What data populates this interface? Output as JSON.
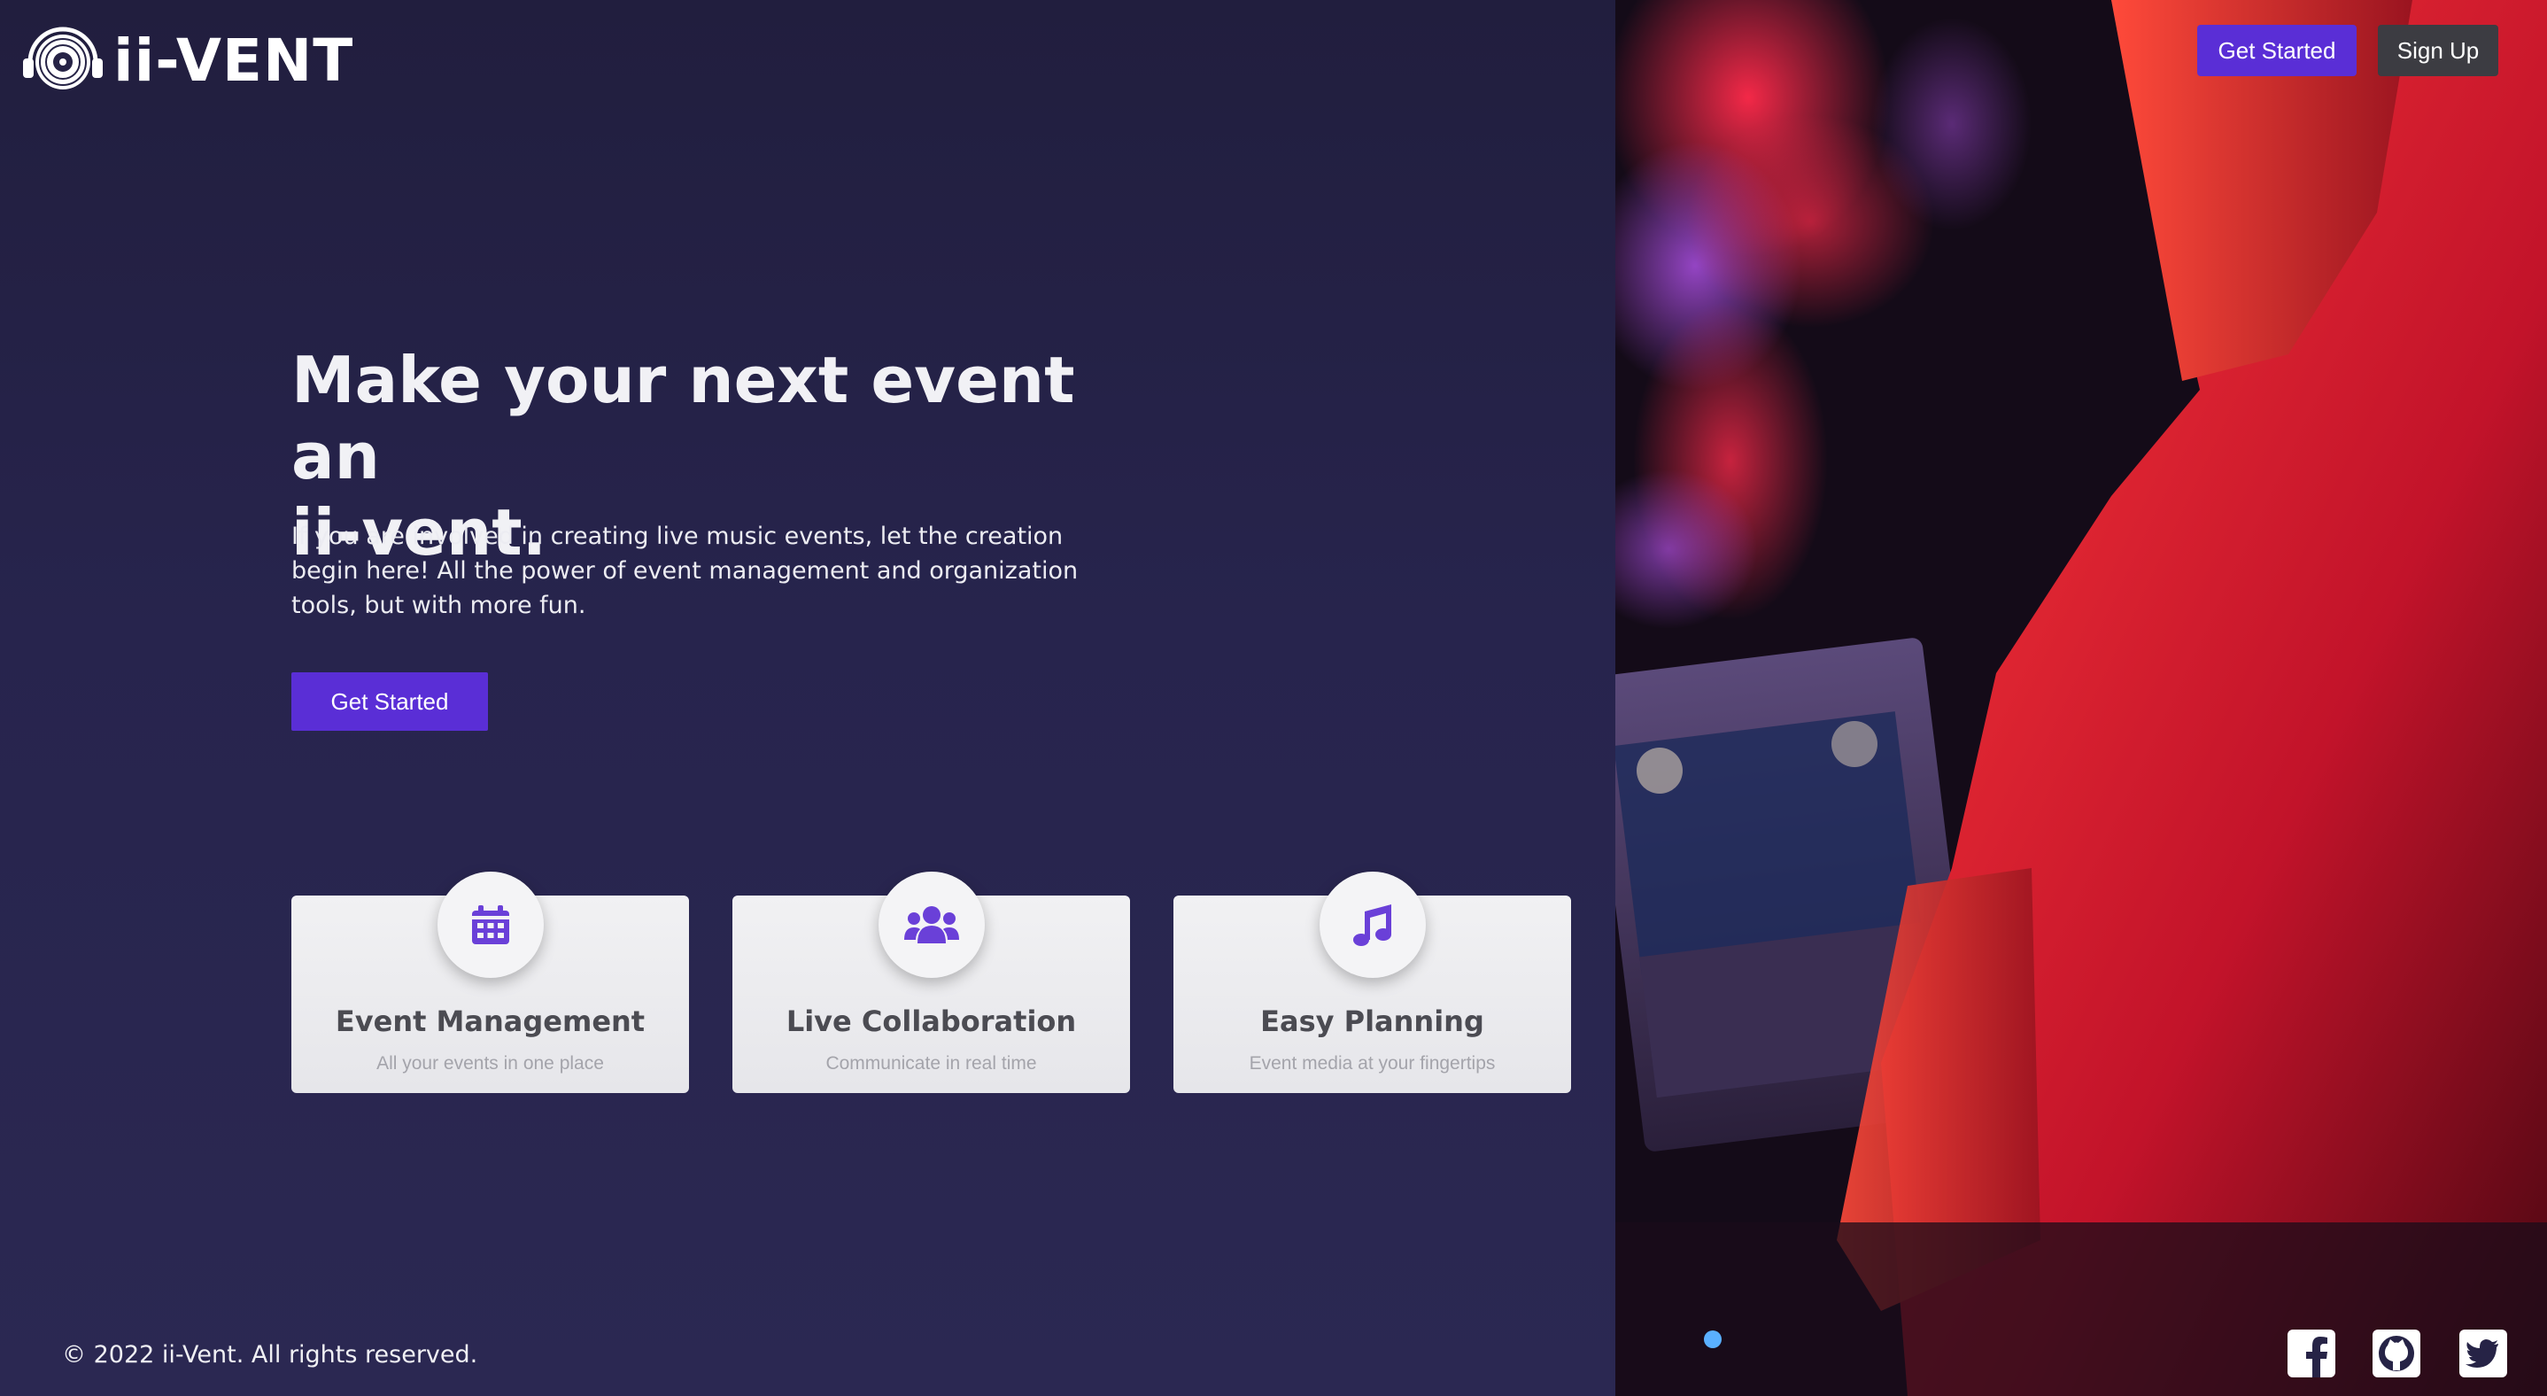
{
  "brand": {
    "name": "ii-VENT"
  },
  "nav": {
    "get_started": "Get Started",
    "sign_up": "Sign Up"
  },
  "hero": {
    "title_line1": "Make your next event an",
    "title_line2": "ii-vent.",
    "subtitle": "If you are involved in creating live music events, let the creation begin here! All the power of event management and organization tools, but with more fun.",
    "cta": "Get Started"
  },
  "features": [
    {
      "icon": "calendar-icon",
      "title": "Event Management",
      "desc": "All your events in one place"
    },
    {
      "icon": "users-icon",
      "title": "Live Collaboration",
      "desc": "Communicate in real time"
    },
    {
      "icon": "music-note-icon",
      "title": "Easy Planning",
      "desc": "Event media at your fingertips"
    }
  ],
  "footer": {
    "copyright": "© 2022 ii-Vent. All rights reserved.",
    "social": [
      "facebook-icon",
      "github-icon",
      "twitter-icon"
    ]
  },
  "colors": {
    "accent": "#5a2ed6",
    "background": "#262346",
    "card": "#ececef",
    "icon": "#6a40d8",
    "secondary_button": "#3c3c42"
  }
}
